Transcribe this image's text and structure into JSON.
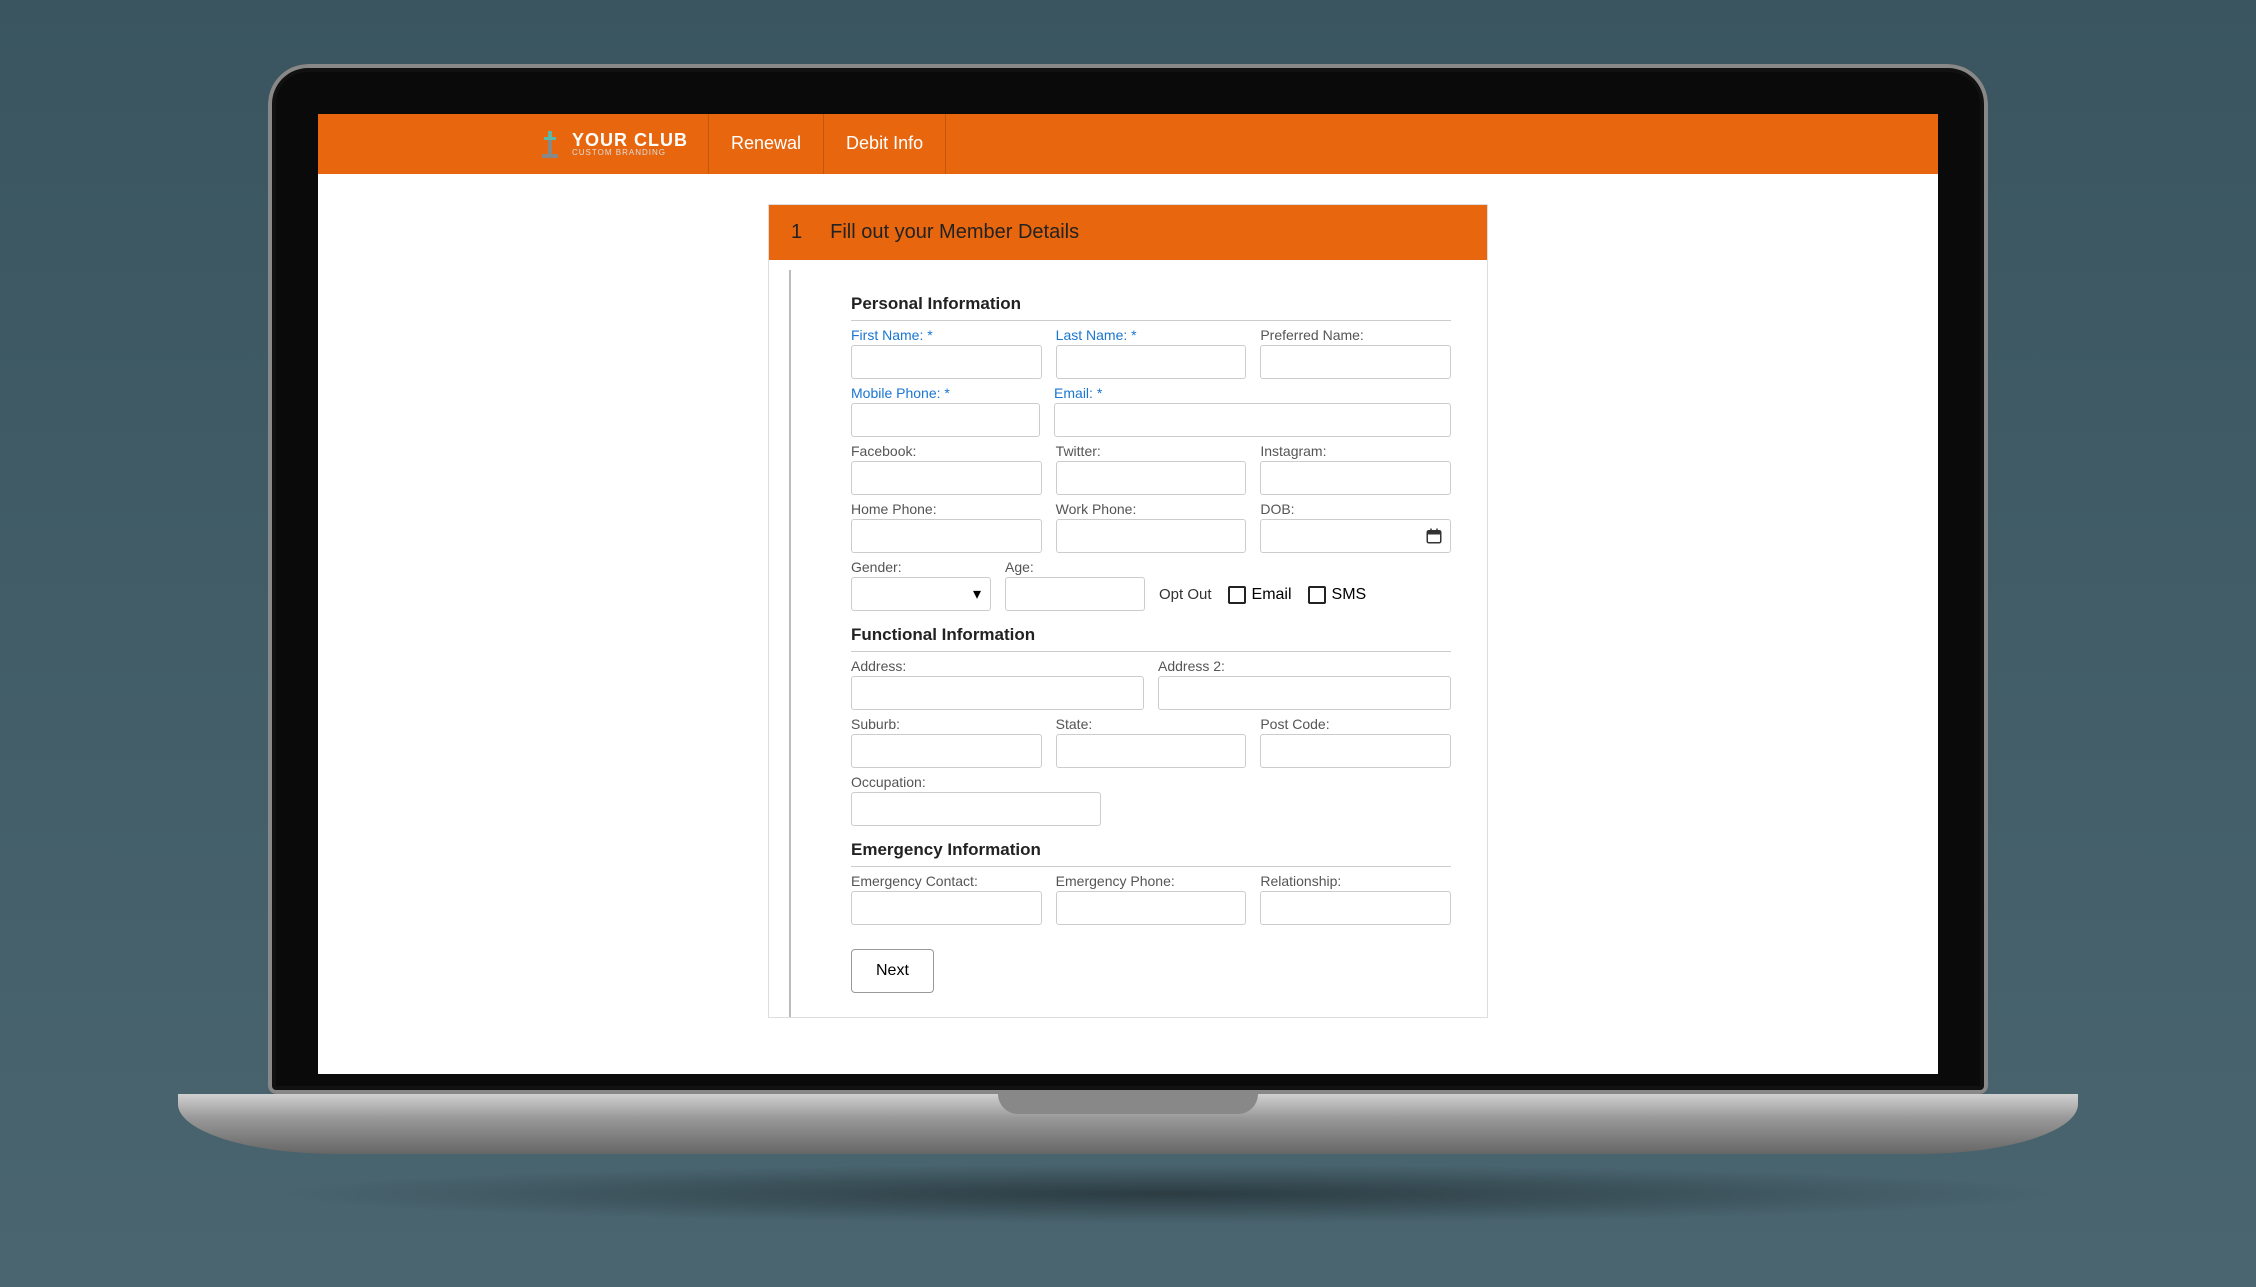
{
  "header": {
    "logo_main": "YOUR CLUB",
    "logo_sub": "CUSTOM BRANDING",
    "nav": [
      "Renewal",
      "Debit Info"
    ]
  },
  "form": {
    "step_number": "1",
    "step_title": "Fill out your Member Details",
    "sections": {
      "personal": {
        "title": "Personal Information",
        "fields": {
          "first_name": "First Name: *",
          "last_name": "Last Name: *",
          "preferred_name": "Preferred Name:",
          "mobile_phone": "Mobile Phone: *",
          "email": "Email: *",
          "facebook": "Facebook:",
          "twitter": "Twitter:",
          "instagram": "Instagram:",
          "home_phone": "Home Phone:",
          "work_phone": "Work Phone:",
          "dob": "DOB:",
          "gender": "Gender:",
          "age": "Age:",
          "opt_out": "Opt Out",
          "opt_email": "Email",
          "opt_sms": "SMS"
        }
      },
      "functional": {
        "title": "Functional Information",
        "fields": {
          "address": "Address:",
          "address2": "Address 2:",
          "suburb": "Suburb:",
          "state": "State:",
          "postcode": "Post Code:",
          "occupation": "Occupation:"
        }
      },
      "emergency": {
        "title": "Emergency Information",
        "fields": {
          "contact": "Emergency Contact:",
          "phone": "Emergency Phone:",
          "relationship": "Relationship:"
        }
      }
    },
    "next_button": "Next"
  },
  "colors": {
    "accent": "#e8670e",
    "required": "#1976d2"
  }
}
